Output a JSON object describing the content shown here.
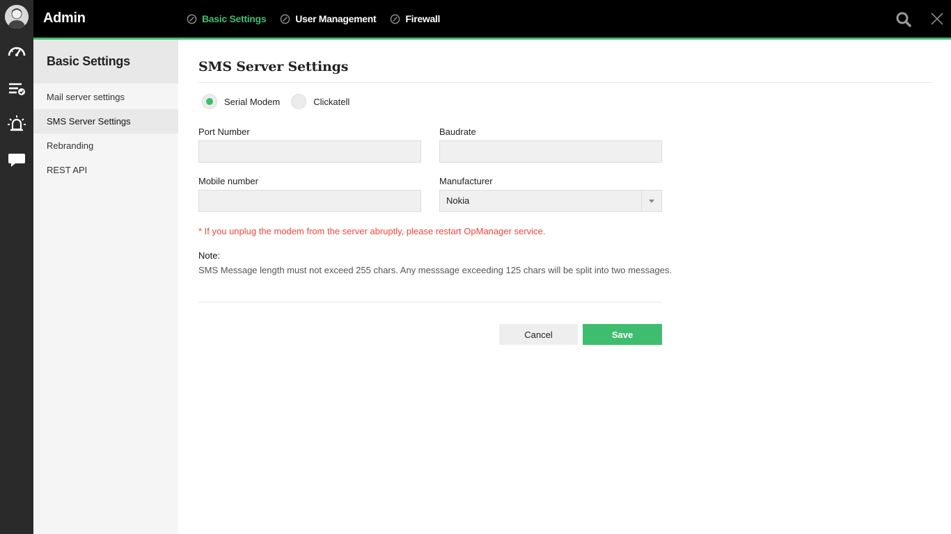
{
  "app": {
    "title": "Admin"
  },
  "topnav": {
    "items": [
      {
        "label": "Basic Settings",
        "active": true
      },
      {
        "label": "User Management",
        "active": false
      },
      {
        "label": "Firewall",
        "active": false
      }
    ],
    "search_icon": "search-icon",
    "close_icon": "close-icon"
  },
  "rail": {
    "icons": [
      "dashboard-gauge-icon",
      "task-list-check-icon",
      "alarm-bell-icon",
      "chat-bubble-icon"
    ]
  },
  "sidebar": {
    "heading": "Basic Settings",
    "items": [
      {
        "label": "Mail server settings",
        "active": false
      },
      {
        "label": "SMS Server Settings",
        "active": true
      },
      {
        "label": "Rebranding",
        "active": false
      },
      {
        "label": "REST API",
        "active": false
      }
    ]
  },
  "main": {
    "title": "SMS Server Settings",
    "radio": {
      "options": [
        {
          "label": "Serial Modem",
          "checked": true
        },
        {
          "label": "Clickatell",
          "checked": false
        }
      ]
    },
    "fields": {
      "port_number": {
        "label": "Port Number",
        "value": ""
      },
      "baudrate": {
        "label": "Baudrate",
        "value": ""
      },
      "mobile_number": {
        "label": "Mobile number",
        "value": ""
      },
      "manufacturer": {
        "label": "Manufacturer",
        "value": "Nokia"
      }
    },
    "warning": "* If you unplug the modem from the server abruptly, please restart OpManager service.",
    "note": {
      "title": "Note:",
      "text": "SMS Message length must not exceed 255 chars. Any messsage exceeding 125 chars will be split into two messages."
    },
    "buttons": {
      "cancel": "Cancel",
      "save": "Save"
    }
  },
  "colors": {
    "accent": "#3ebd6e",
    "warning": "#f0463c",
    "topbar": "#000000",
    "rail": "#2a2a2a"
  }
}
